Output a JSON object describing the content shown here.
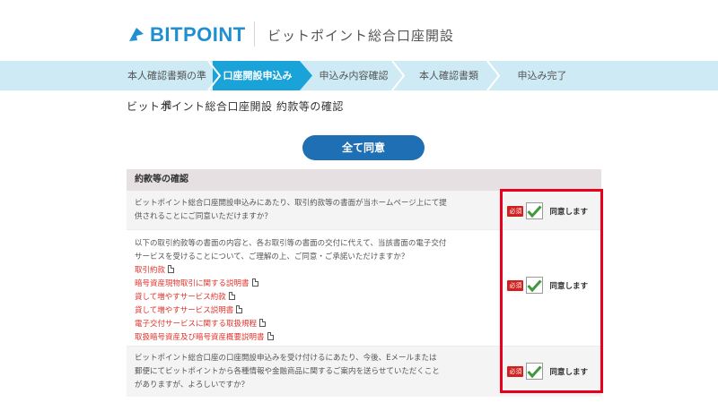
{
  "header": {
    "logo_text": "BITPOINT",
    "title": "ビットポイント総合口座開設"
  },
  "steps": [
    {
      "label": "本人確認書類の準備",
      "active": false
    },
    {
      "label": "口座開設申込み",
      "active": true
    },
    {
      "label": "申込み内容確認",
      "active": false
    },
    {
      "label": "本人確認書類",
      "active": false
    },
    {
      "label": "申込み完了",
      "active": false
    }
  ],
  "page_title": "ビットポイント総合口座開設 約款等の確認",
  "agree_all_label": "全て同意",
  "table": {
    "heading": "約款等の確認",
    "rows": [
      {
        "text": "ビットポイント総合口座開設申込みにあたり、取引約款等の書面が当ホームページ上にて提供されることにご同意いただけますか？",
        "required": "必須",
        "agree": "同意します"
      },
      {
        "text": "以下の取引約款等の書面の内容と、各お取引等の書面の交付に代えて、当該書面の電子交付サービスを受けることについて、ご理解の上、ご同意・ご承諾いただけますか？",
        "links": [
          "取引約款",
          "暗号資産現物取引に関する説明書",
          "貸して増やすサービス約款",
          "貸して増やすサービス説明書",
          "電子交付サービスに関する取扱規程",
          "取扱暗号資産及び暗号資産概要説明書"
        ],
        "required": "必須",
        "agree": "同意します"
      },
      {
        "text": "ビットポイント総合口座の口座開設申込みを受け付けるにあたり、今後、Eメールまたは郵便にてビットポイントから各種情報や金融商品に関するご案内を送らせていただくことがありますが、よろしいですか？",
        "required": "必須",
        "agree": "同意します"
      }
    ]
  },
  "colors": {
    "brand_blue": "#1f8fd1",
    "step_bar": "#cdeaf5",
    "step_active": "#1aa3d9",
    "button": "#1f6fb5",
    "required_red": "#d22020",
    "highlight_frame": "#e8001c",
    "check_green": "#3e9a3a"
  }
}
